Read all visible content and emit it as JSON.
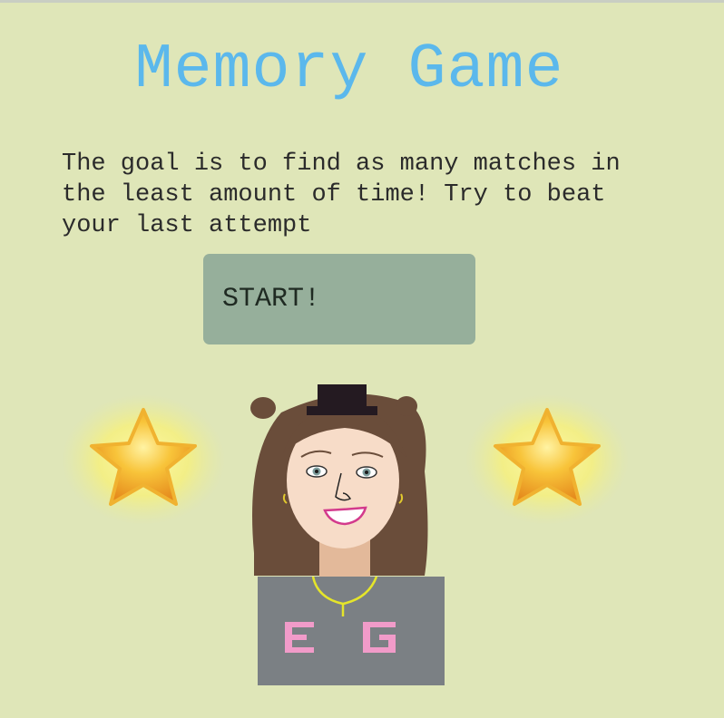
{
  "game": {
    "title": "Memory Game",
    "description": "The goal is to find as many matches in the least amount of time! Try to beat your last attempt",
    "start_label": "START!"
  },
  "avatar": {
    "shirt_letters": [
      "E",
      "G"
    ]
  },
  "colors": {
    "background": "#dfe6b8",
    "title": "#5bb8ec",
    "button": "#96af9b",
    "shirt": "#7b8084",
    "shirt_letters": "#f19bc9",
    "hair": "#6a4d3a",
    "hat": "#241a21"
  },
  "icons": [
    "star-icon",
    "star-icon"
  ]
}
